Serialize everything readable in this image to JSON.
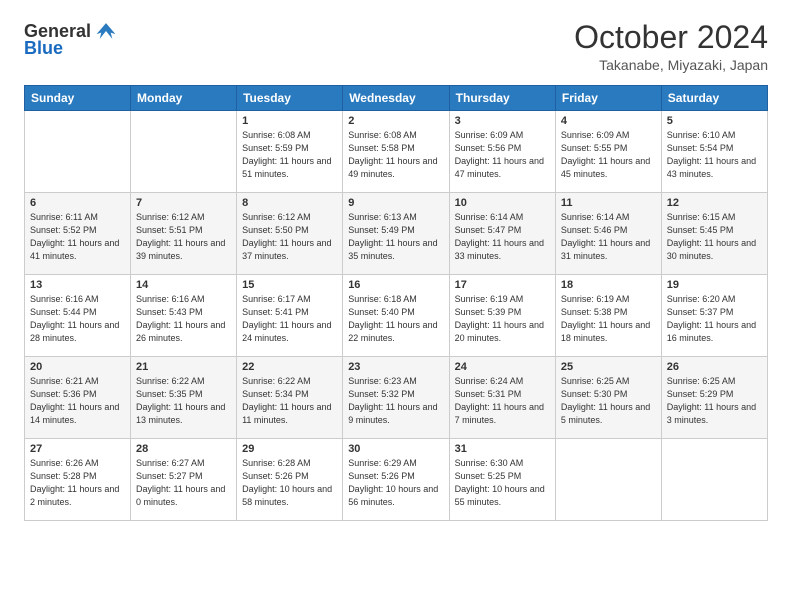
{
  "header": {
    "logo_general": "General",
    "logo_blue": "Blue",
    "month": "October 2024",
    "location": "Takanabe, Miyazaki, Japan"
  },
  "days_of_week": [
    "Sunday",
    "Monday",
    "Tuesday",
    "Wednesday",
    "Thursday",
    "Friday",
    "Saturday"
  ],
  "weeks": [
    [
      {
        "day": "",
        "info": ""
      },
      {
        "day": "",
        "info": ""
      },
      {
        "day": "1",
        "info": "Sunrise: 6:08 AM\nSunset: 5:59 PM\nDaylight: 11 hours and 51 minutes."
      },
      {
        "day": "2",
        "info": "Sunrise: 6:08 AM\nSunset: 5:58 PM\nDaylight: 11 hours and 49 minutes."
      },
      {
        "day": "3",
        "info": "Sunrise: 6:09 AM\nSunset: 5:56 PM\nDaylight: 11 hours and 47 minutes."
      },
      {
        "day": "4",
        "info": "Sunrise: 6:09 AM\nSunset: 5:55 PM\nDaylight: 11 hours and 45 minutes."
      },
      {
        "day": "5",
        "info": "Sunrise: 6:10 AM\nSunset: 5:54 PM\nDaylight: 11 hours and 43 minutes."
      }
    ],
    [
      {
        "day": "6",
        "info": "Sunrise: 6:11 AM\nSunset: 5:52 PM\nDaylight: 11 hours and 41 minutes."
      },
      {
        "day": "7",
        "info": "Sunrise: 6:12 AM\nSunset: 5:51 PM\nDaylight: 11 hours and 39 minutes."
      },
      {
        "day": "8",
        "info": "Sunrise: 6:12 AM\nSunset: 5:50 PM\nDaylight: 11 hours and 37 minutes."
      },
      {
        "day": "9",
        "info": "Sunrise: 6:13 AM\nSunset: 5:49 PM\nDaylight: 11 hours and 35 minutes."
      },
      {
        "day": "10",
        "info": "Sunrise: 6:14 AM\nSunset: 5:47 PM\nDaylight: 11 hours and 33 minutes."
      },
      {
        "day": "11",
        "info": "Sunrise: 6:14 AM\nSunset: 5:46 PM\nDaylight: 11 hours and 31 minutes."
      },
      {
        "day": "12",
        "info": "Sunrise: 6:15 AM\nSunset: 5:45 PM\nDaylight: 11 hours and 30 minutes."
      }
    ],
    [
      {
        "day": "13",
        "info": "Sunrise: 6:16 AM\nSunset: 5:44 PM\nDaylight: 11 hours and 28 minutes."
      },
      {
        "day": "14",
        "info": "Sunrise: 6:16 AM\nSunset: 5:43 PM\nDaylight: 11 hours and 26 minutes."
      },
      {
        "day": "15",
        "info": "Sunrise: 6:17 AM\nSunset: 5:41 PM\nDaylight: 11 hours and 24 minutes."
      },
      {
        "day": "16",
        "info": "Sunrise: 6:18 AM\nSunset: 5:40 PM\nDaylight: 11 hours and 22 minutes."
      },
      {
        "day": "17",
        "info": "Sunrise: 6:19 AM\nSunset: 5:39 PM\nDaylight: 11 hours and 20 minutes."
      },
      {
        "day": "18",
        "info": "Sunrise: 6:19 AM\nSunset: 5:38 PM\nDaylight: 11 hours and 18 minutes."
      },
      {
        "day": "19",
        "info": "Sunrise: 6:20 AM\nSunset: 5:37 PM\nDaylight: 11 hours and 16 minutes."
      }
    ],
    [
      {
        "day": "20",
        "info": "Sunrise: 6:21 AM\nSunset: 5:36 PM\nDaylight: 11 hours and 14 minutes."
      },
      {
        "day": "21",
        "info": "Sunrise: 6:22 AM\nSunset: 5:35 PM\nDaylight: 11 hours and 13 minutes."
      },
      {
        "day": "22",
        "info": "Sunrise: 6:22 AM\nSunset: 5:34 PM\nDaylight: 11 hours and 11 minutes."
      },
      {
        "day": "23",
        "info": "Sunrise: 6:23 AM\nSunset: 5:32 PM\nDaylight: 11 hours and 9 minutes."
      },
      {
        "day": "24",
        "info": "Sunrise: 6:24 AM\nSunset: 5:31 PM\nDaylight: 11 hours and 7 minutes."
      },
      {
        "day": "25",
        "info": "Sunrise: 6:25 AM\nSunset: 5:30 PM\nDaylight: 11 hours and 5 minutes."
      },
      {
        "day": "26",
        "info": "Sunrise: 6:25 AM\nSunset: 5:29 PM\nDaylight: 11 hours and 3 minutes."
      }
    ],
    [
      {
        "day": "27",
        "info": "Sunrise: 6:26 AM\nSunset: 5:28 PM\nDaylight: 11 hours and 2 minutes."
      },
      {
        "day": "28",
        "info": "Sunrise: 6:27 AM\nSunset: 5:27 PM\nDaylight: 11 hours and 0 minutes."
      },
      {
        "day": "29",
        "info": "Sunrise: 6:28 AM\nSunset: 5:26 PM\nDaylight: 10 hours and 58 minutes."
      },
      {
        "day": "30",
        "info": "Sunrise: 6:29 AM\nSunset: 5:26 PM\nDaylight: 10 hours and 56 minutes."
      },
      {
        "day": "31",
        "info": "Sunrise: 6:30 AM\nSunset: 5:25 PM\nDaylight: 10 hours and 55 minutes."
      },
      {
        "day": "",
        "info": ""
      },
      {
        "day": "",
        "info": ""
      }
    ]
  ]
}
